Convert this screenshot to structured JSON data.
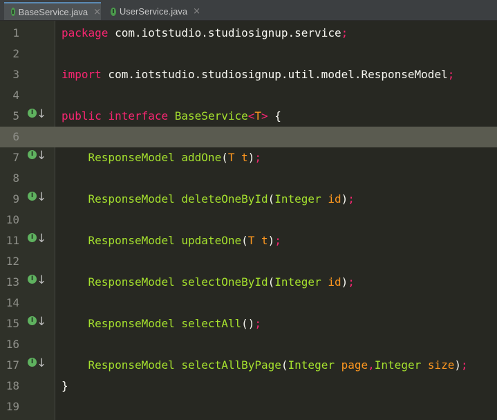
{
  "tabs": [
    {
      "label": "BaseService.java",
      "icon": "interface-icon",
      "icon_letter": "I",
      "active": true
    },
    {
      "label": "UserService.java",
      "icon": "interface-icon",
      "icon_letter": "I",
      "active": false
    }
  ],
  "tab_close_glyph": "×",
  "gutter_icon": {
    "letter": "I",
    "arrow": "↓",
    "name": "implemented-interface-icon"
  },
  "current_line": 6,
  "colors": {
    "background": "#272822",
    "keyword": "#f92672",
    "type": "#a6e22e",
    "type_param": "#fd971f",
    "text": "#f8f8f2",
    "current_line": "#5a5b50"
  },
  "lines": [
    {
      "num": "1",
      "tokens": [
        {
          "t": "package",
          "c": "kw"
        },
        {
          "t": " com.iotstudio.studiosignup.service",
          "c": "pkg"
        },
        {
          "t": ";",
          "c": "semi"
        }
      ]
    },
    {
      "num": "2",
      "tokens": []
    },
    {
      "num": "3",
      "tokens": [
        {
          "t": "import",
          "c": "kw"
        },
        {
          "t": " com.iotstudio.studiosignup.util.model.ResponseModel",
          "c": "pkg"
        },
        {
          "t": ";",
          "c": "semi"
        }
      ]
    },
    {
      "num": "4",
      "tokens": []
    },
    {
      "num": "5",
      "icon": true,
      "tokens": [
        {
          "t": "public",
          "c": "kw"
        },
        {
          "t": " ",
          "c": "pl"
        },
        {
          "t": "interface",
          "c": "kw"
        },
        {
          "t": " BaseService",
          "c": "typ"
        },
        {
          "t": "<",
          "c": "kw"
        },
        {
          "t": "T",
          "c": "tp"
        },
        {
          "t": ">",
          "c": "kw"
        },
        {
          "t": " {",
          "c": "pl"
        }
      ]
    },
    {
      "num": "6",
      "tokens": []
    },
    {
      "num": "7",
      "icon": true,
      "tokens": [
        {
          "t": "    ResponseModel",
          "c": "typ"
        },
        {
          "t": " addOne",
          "c": "fn"
        },
        {
          "t": "(",
          "c": "pl"
        },
        {
          "t": "T",
          "c": "tp"
        },
        {
          "t": " t",
          "c": "pn"
        },
        {
          "t": ")",
          "c": "pl"
        },
        {
          "t": ";",
          "c": "semi"
        }
      ]
    },
    {
      "num": "8",
      "tokens": []
    },
    {
      "num": "9",
      "icon": true,
      "tokens": [
        {
          "t": "    ResponseModel",
          "c": "typ"
        },
        {
          "t": " deleteOneById",
          "c": "fn"
        },
        {
          "t": "(",
          "c": "pl"
        },
        {
          "t": "Integer",
          "c": "ptype"
        },
        {
          "t": " id",
          "c": "pn"
        },
        {
          "t": ")",
          "c": "pl"
        },
        {
          "t": ";",
          "c": "semi"
        }
      ]
    },
    {
      "num": "10",
      "tokens": []
    },
    {
      "num": "11",
      "icon": true,
      "tokens": [
        {
          "t": "    ResponseModel",
          "c": "typ"
        },
        {
          "t": " updateOne",
          "c": "fn"
        },
        {
          "t": "(",
          "c": "pl"
        },
        {
          "t": "T",
          "c": "tp"
        },
        {
          "t": " t",
          "c": "pn"
        },
        {
          "t": ")",
          "c": "pl"
        },
        {
          "t": ";",
          "c": "semi"
        }
      ]
    },
    {
      "num": "12",
      "tokens": []
    },
    {
      "num": "13",
      "icon": true,
      "tokens": [
        {
          "t": "    ResponseModel",
          "c": "typ"
        },
        {
          "t": " selectOneById",
          "c": "fn"
        },
        {
          "t": "(",
          "c": "pl"
        },
        {
          "t": "Integer",
          "c": "ptype"
        },
        {
          "t": " id",
          "c": "pn"
        },
        {
          "t": ")",
          "c": "pl"
        },
        {
          "t": ";",
          "c": "semi"
        }
      ]
    },
    {
      "num": "14",
      "tokens": []
    },
    {
      "num": "15",
      "icon": true,
      "tokens": [
        {
          "t": "    ResponseModel",
          "c": "typ"
        },
        {
          "t": " selectAll",
          "c": "fn"
        },
        {
          "t": "()",
          "c": "pl"
        },
        {
          "t": ";",
          "c": "semi"
        }
      ]
    },
    {
      "num": "16",
      "tokens": []
    },
    {
      "num": "17",
      "icon": true,
      "tokens": [
        {
          "t": "    ResponseModel",
          "c": "typ"
        },
        {
          "t": " selectAllByPage",
          "c": "fn"
        },
        {
          "t": "(",
          "c": "pl"
        },
        {
          "t": "Integer",
          "c": "ptype"
        },
        {
          "t": " page",
          "c": "pn"
        },
        {
          "t": ",",
          "c": "semi"
        },
        {
          "t": "Integer",
          "c": "ptype"
        },
        {
          "t": " size",
          "c": "pn"
        },
        {
          "t": ")",
          "c": "pl"
        },
        {
          "t": ";",
          "c": "semi"
        }
      ]
    },
    {
      "num": "18",
      "tokens": [
        {
          "t": "}",
          "c": "pl"
        }
      ]
    },
    {
      "num": "19",
      "tokens": []
    }
  ]
}
